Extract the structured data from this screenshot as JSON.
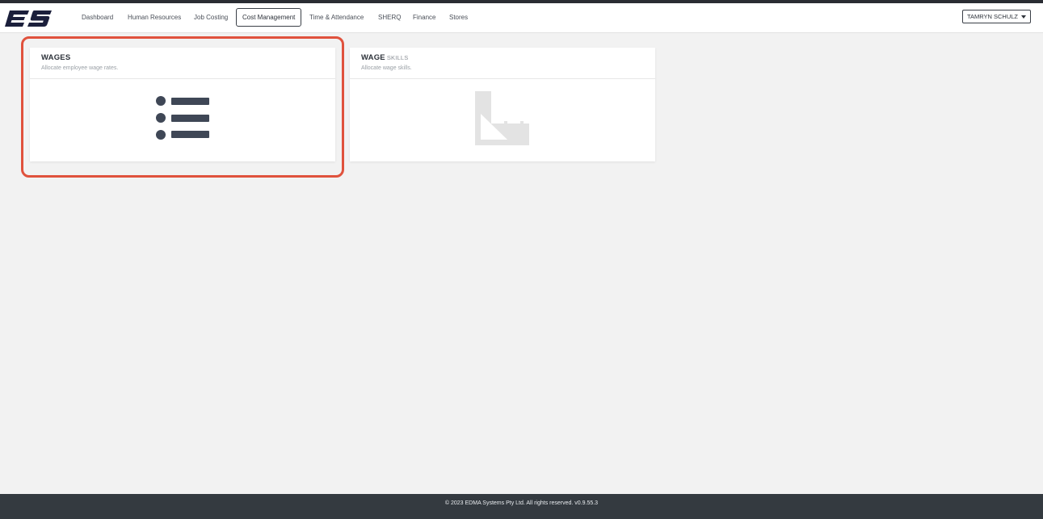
{
  "app": {
    "logo_text": "ES"
  },
  "nav": {
    "items": [
      {
        "label": "Dashboard"
      },
      {
        "label": "Human Resources"
      },
      {
        "label": "Job Costing"
      },
      {
        "label": "Cost Management"
      },
      {
        "label": "Time & Attendance"
      },
      {
        "label": "SHERQ"
      },
      {
        "label": "Finance"
      },
      {
        "label": "Stores"
      }
    ],
    "active_label": "Cost Management"
  },
  "user": {
    "name": "TAMRYN SCHULZ"
  },
  "cards": [
    {
      "title": "WAGES",
      "title_suffix": "",
      "description": "Allocate employee wage rates.",
      "icon": "list-icon",
      "highlighted": true
    },
    {
      "title": "WAGE",
      "title_suffix": "SKILLS",
      "description": "Allocate wage skills.",
      "icon": "ruler-icon",
      "highlighted": false
    }
  ],
  "footer": {
    "text": "© 2023 EDMA Systems Pty Ltd. All rights reserved. v0.9.55.3"
  },
  "colors": {
    "highlight": "#e0523d",
    "navbar_bg": "#ffffff",
    "page_bg": "#f2f2f2",
    "footer_bg": "#343a40",
    "logo": "#1b1f3b",
    "icon_dark": "#3f4756",
    "icon_light": "#e3e3e3"
  }
}
